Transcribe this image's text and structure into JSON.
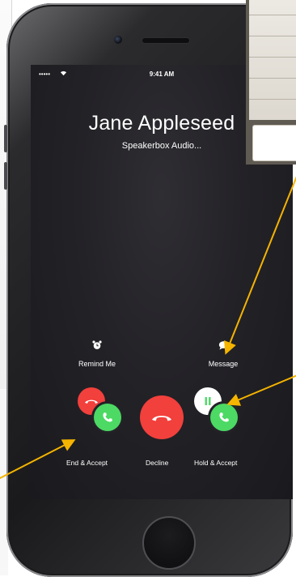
{
  "status_bar": {
    "signal": "•••••",
    "time": "9:41 AM"
  },
  "caller": {
    "name": "Jane Appleseed",
    "app": "Speakerbox Audio..."
  },
  "options": {
    "remind_me": "Remind Me",
    "message": "Message"
  },
  "buttons": {
    "end_accept": "End & Accept",
    "decline": "Decline",
    "hold_accept": "Hold & Accept"
  },
  "colors": {
    "decline_red": "#f2403c",
    "accept_green": "#4cd964",
    "annotation_arrow": "#f5b400"
  },
  "icons": {
    "alarm": "alarm-clock-icon",
    "message": "speech-bubble-icon",
    "hangup": "phone-hangup-icon",
    "accept": "phone-icon",
    "hold": "pause-icon"
  }
}
